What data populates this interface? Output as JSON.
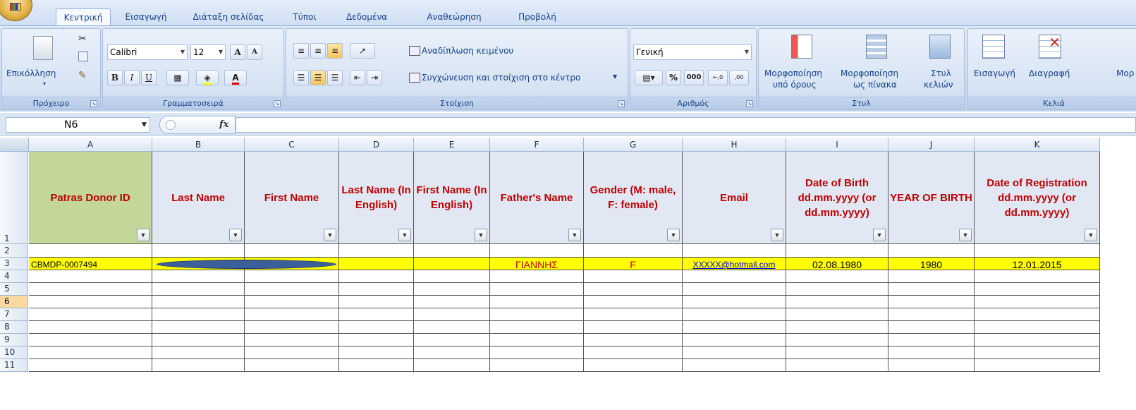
{
  "tabs": [
    "Κεντρική",
    "Εισαγωγή",
    "Διάταξη σελίδας",
    "Τύποι",
    "Δεδομένα",
    "Αναθεώρηση",
    "Προβολή"
  ],
  "active_tab": "Κεντρική",
  "clipboard": {
    "paste_label": "Επικόλληση",
    "group": "Πρόχειρο"
  },
  "font": {
    "name": "Calibri",
    "size": "12",
    "group": "Γραμματοσειρά",
    "bold": "B",
    "italic": "I",
    "underline": "U",
    "grow": "A",
    "shrink": "A",
    "color": "A"
  },
  "alignment": {
    "wrap": "Αναδίπλωση κειμένου",
    "merge": "Συγχώνευση και στοίχιση στο κέντρο",
    "group": "Στοίχιση"
  },
  "number": {
    "format": "Γενική",
    "percent": "%",
    "thousands": "000",
    "increase": "←,0",
    "decrease": ",00",
    "group": "Αριθμός"
  },
  "styles": {
    "conditional_1": "Μορφοποίηση",
    "conditional_2": "υπό όρους",
    "astable_1": "Μορφοποίηση",
    "astable_2": "ως πίνακα",
    "cell_1": "Στυλ",
    "cell_2": "κελιών",
    "group": "Στυλ"
  },
  "cells": {
    "insert": "Εισαγωγή",
    "delete": "Διαγραφή",
    "format": "Μορ",
    "group": "Κελιά"
  },
  "namebox": "N6",
  "fx": "fx",
  "columns": [
    "A",
    "B",
    "C",
    "D",
    "E",
    "F",
    "G",
    "H",
    "I",
    "J",
    "K"
  ],
  "rows": [
    "1",
    "2",
    "3",
    "4",
    "5",
    "6",
    "7",
    "8",
    "9",
    "10",
    "11"
  ],
  "headers": [
    "Patras Donor ID",
    "Last Name",
    "First Name",
    "Last Name (In English)",
    "First Name (In English)",
    "Father's Name",
    "Gender (M: male, F: female)",
    "Email",
    "Date of Birth dd.mm.yyyy (or dd.mm.yyyy)",
    "YEAR OF BIRTH",
    "Date of Registration dd.mm.yyyy (or dd.mm.yyyy)"
  ],
  "row3": {
    "donor_id": "CBMDP-0007494",
    "last_name": "",
    "first_name": "",
    "last_name_en": "",
    "first_name_en": "",
    "father": "ΓΙΑΝΝΗΣ",
    "gender": "F",
    "email": "XXXXX@hotmail.com",
    "dob": "02.08.1980",
    "yob": "1980",
    "reg": "12.01.2015"
  },
  "colors": {
    "header_text": "#c00000",
    "highlight": "#ffff00",
    "id_header_bg": "#c4d79b",
    "header_bg": "#e1e8f4",
    "redaction": "#3b5f9a"
  }
}
